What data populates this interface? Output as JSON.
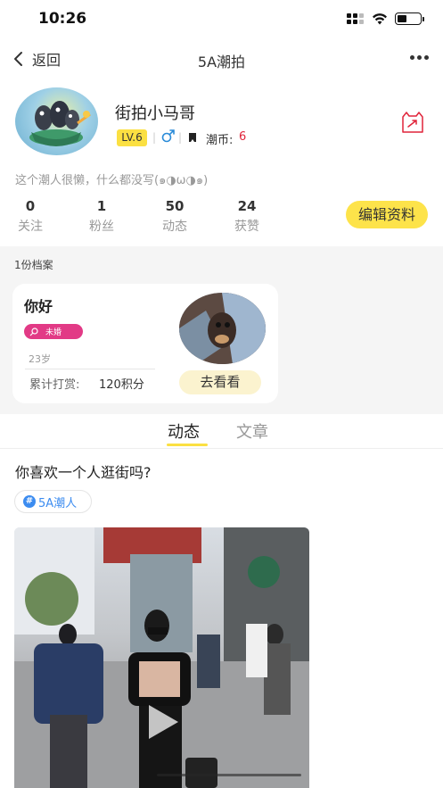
{
  "status_bar": {
    "time": "10:26"
  },
  "nav": {
    "back_label": "返回",
    "title": "5A潮拍"
  },
  "profile": {
    "username": "街拍小马哥",
    "level": "LV.6",
    "coin_label": "潮币:",
    "coin_value": "6",
    "bio": "这个潮人很懒，什么都没写(๑◑ω◑๑)",
    "stats": [
      {
        "value": "0",
        "label": "关注"
      },
      {
        "value": "1",
        "label": "粉丝"
      },
      {
        "value": "50",
        "label": "动态"
      },
      {
        "value": "24",
        "label": "获赞"
      }
    ],
    "edit_label": "编辑资料"
  },
  "archives": {
    "count_label": "1份档案",
    "card": {
      "name": "你好",
      "marital_status": "未婚",
      "age": "23岁",
      "reward_label": "累计打赏:",
      "reward_value": "120积分",
      "view_label": "去看看"
    }
  },
  "tabs": [
    {
      "label": "动态",
      "active": true
    },
    {
      "label": "文章",
      "active": false
    }
  ],
  "post": {
    "title": "你喜欢一个人逛街吗?",
    "topic": "5A潮人"
  },
  "colors": {
    "accent_yellow": "#fbe042",
    "coin_red": "#e0243a",
    "badge_pink": "#e23a86",
    "topic_blue": "#3c8cf0",
    "gender_blue": "#2a8bd8"
  }
}
